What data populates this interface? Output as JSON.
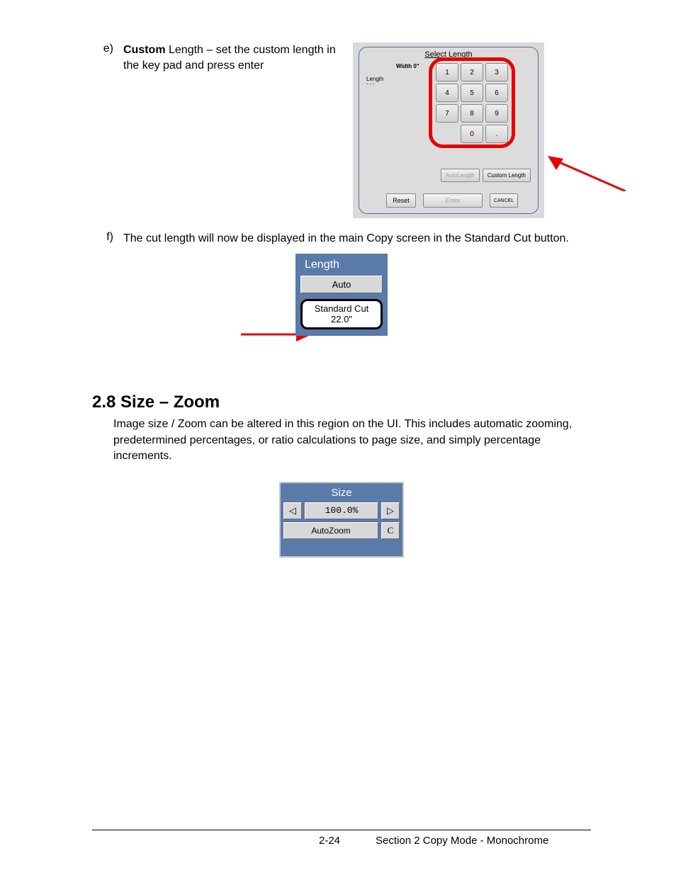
{
  "item_e": {
    "letter": "e)",
    "bold": "Custom",
    "rest": " Length – set the custom length in the key pad and press enter"
  },
  "select_panel": {
    "title": "Select Length",
    "width_label": "Width 0\"",
    "length_label": "Length",
    "length_sub": "- - -",
    "keys": [
      "1",
      "2",
      "3",
      "4",
      "5",
      "6",
      "7",
      "8",
      "9",
      "",
      "0",
      "."
    ],
    "auto_btn": "AutoLength",
    "custom_btn": "Custom Length",
    "reset": "Reset",
    "enter": "Enter",
    "cancel": "CANCEL"
  },
  "item_f": {
    "letter": "f)",
    "text": "The cut length will now be displayed in the main Copy screen in the Standard Cut button."
  },
  "length_widget": {
    "header": "Length",
    "auto": "Auto",
    "std_line1": "Standard Cut",
    "std_line2": "22.0\""
  },
  "section": {
    "title": "2.8  Size – Zoom",
    "body": "Image size / Zoom can be altered in this region on the UI. This includes automatic zooming, predetermined percentages, or ratio calculations to page size, and simply percentage increments."
  },
  "size_widget": {
    "header": "Size",
    "left": "◁",
    "percent": "100.0%",
    "right": "▷",
    "autozoom": "AutoZoom",
    "c": "C"
  },
  "footer": {
    "page": "2-24",
    "section": "Section 2    Copy Mode - Monochrome"
  }
}
